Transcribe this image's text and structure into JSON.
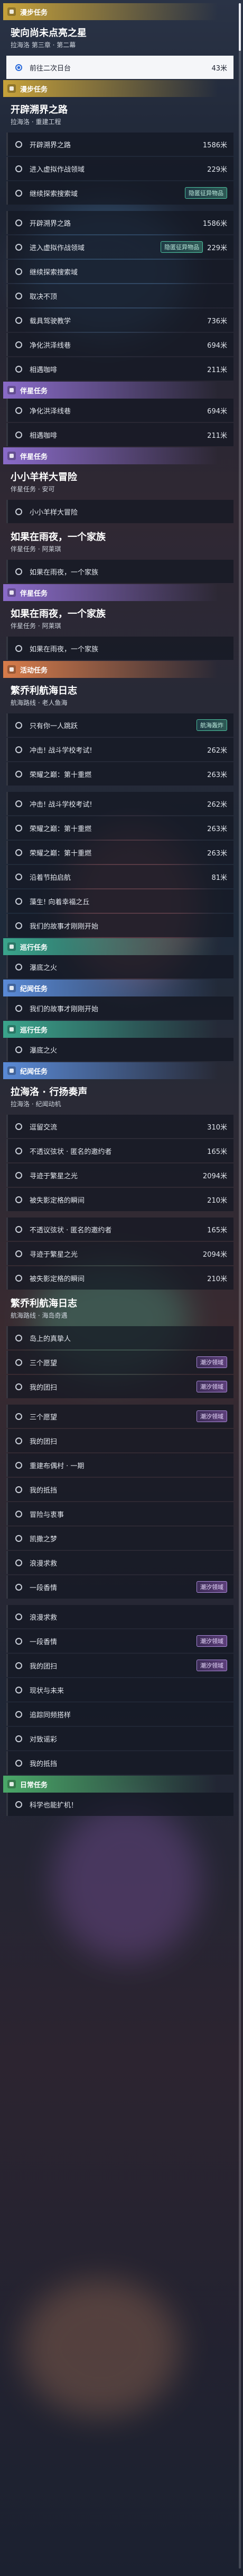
{
  "colors": {
    "mainline": "#c7a23a",
    "bond": "#8a6bc9",
    "event": "#d87c4a",
    "tour": "#3aa58c",
    "story": "#5a8ad6",
    "wild": "#4aa868"
  },
  "entries": [
    {
      "kind": "header",
      "label": "漫步任务",
      "color": "#c7a23a",
      "icon": "star-icon"
    },
    {
      "kind": "title",
      "text": "驶向尚未点亮之星",
      "sub": "拉海洛 第三章 · 第二幕"
    },
    {
      "kind": "row",
      "text": "前往二次日台",
      "dist": "43米",
      "selected": true
    },
    {
      "kind": "header",
      "label": "漫步任务",
      "color": "#c7a23a",
      "icon": "star-icon"
    },
    {
      "kind": "title",
      "text": "开辟溯界之路",
      "sub": "拉海洛 · 重建工程"
    },
    {
      "kind": "row",
      "text": "开辟溯界之路",
      "dist": "1586米"
    },
    {
      "kind": "row",
      "text": "进入虚拟作战领域",
      "dist": "229米"
    },
    {
      "kind": "row",
      "text": "继续探索搜索域",
      "badge": "隐匿征异物品"
    },
    {
      "kind": "gap"
    },
    {
      "kind": "row",
      "text": "开辟溯界之路",
      "dist": "1586米"
    },
    {
      "kind": "row",
      "text": "进入虚拟作战领域",
      "dist": "229米",
      "badge": "隐匿征异物品"
    },
    {
      "kind": "row",
      "text": "继续探索搜索域"
    },
    {
      "kind": "row",
      "text": "取决不顶"
    },
    {
      "kind": "row",
      "text": "载具驾驶教学",
      "dist": "736米"
    },
    {
      "kind": "row",
      "text": "净化洪泽线巷",
      "dist": "694米"
    },
    {
      "kind": "row",
      "text": "相遇咖啡",
      "dist": "211米"
    },
    {
      "kind": "header",
      "label": "伴星任务",
      "color": "#8a6bc9",
      "icon": "heart-icon"
    },
    {
      "kind": "row",
      "text": "净化洪泽线巷",
      "dist": "694米"
    },
    {
      "kind": "row",
      "text": "相遇咖啡",
      "dist": "211米"
    },
    {
      "kind": "header",
      "label": "伴星任务",
      "color": "#8a6bc9",
      "icon": "heart-icon"
    },
    {
      "kind": "title",
      "text": "小小羊样大冒险",
      "sub": "伴星任务 · 安可"
    },
    {
      "kind": "row",
      "text": "小小羊样大冒险"
    },
    {
      "kind": "title",
      "text": "如果在雨夜，一个家族",
      "sub": "伴星任务 · 阿莱琪"
    },
    {
      "kind": "row",
      "text": "如果在雨夜，一个家族"
    },
    {
      "kind": "header",
      "label": "伴星任务",
      "color": "#8a6bc9",
      "icon": "heart-icon"
    },
    {
      "kind": "title",
      "text": "如果在雨夜，一个家族",
      "sub": "伴星任务 · 阿莱琪"
    },
    {
      "kind": "row",
      "text": "如果在雨夜，一个家族"
    },
    {
      "kind": "header",
      "label": "活动任务",
      "color": "#d87c4a",
      "icon": "flag-icon"
    },
    {
      "kind": "title",
      "text": "繁乔利航海日志",
      "sub": "航海路线 · 老人鱼海"
    },
    {
      "kind": "row",
      "text": "只有你一人跳跃",
      "badge": "航海轰炸"
    },
    {
      "kind": "row",
      "text": "冲击! 战斗学校考试!",
      "dist": "262米"
    },
    {
      "kind": "row",
      "text": "荣耀之巅：第十重燃",
      "dist": "263米"
    },
    {
      "kind": "gap"
    },
    {
      "kind": "row",
      "text": "冲击! 战斗学校考试!",
      "dist": "262米"
    },
    {
      "kind": "row",
      "text": "荣耀之巅：第十重燃",
      "dist": "263米"
    },
    {
      "kind": "row",
      "text": "荣耀之巅：第十重燃",
      "dist": "263米"
    },
    {
      "kind": "row",
      "text": "沿着节拍启航",
      "dist": "81米"
    },
    {
      "kind": "row",
      "text": "藻生! 向着幸福之丘"
    },
    {
      "kind": "row",
      "text": "我们的故事才刚刚开始"
    },
    {
      "kind": "header",
      "label": "巡行任务",
      "color": "#3aa58c",
      "icon": "compass-icon"
    },
    {
      "kind": "row",
      "text": "瀑底之火"
    },
    {
      "kind": "header",
      "label": "纪闻任务",
      "color": "#5a8ad6",
      "icon": "book-icon"
    },
    {
      "kind": "row",
      "text": "我们的故事才刚刚开始"
    },
    {
      "kind": "header",
      "label": "巡行任务",
      "color": "#3aa58c",
      "icon": "compass-icon"
    },
    {
      "kind": "row",
      "text": "瀑底之火"
    },
    {
      "kind": "header",
      "label": "纪闻任务",
      "color": "#5a8ad6",
      "icon": "book-icon"
    },
    {
      "kind": "title",
      "text": "拉海洛 · 行扬奏声",
      "sub": "拉海洛 · 纪闻动机"
    },
    {
      "kind": "row",
      "text": "逗留交流",
      "dist": "310米"
    },
    {
      "kind": "row",
      "text": "不透议弦状 · 匿名的邀约者",
      "dist": "165米"
    },
    {
      "kind": "row",
      "text": "寻迹于繁星之光",
      "dist": "2094米"
    },
    {
      "kind": "row",
      "text": "被失影定格的瞬间",
      "dist": "210米"
    },
    {
      "kind": "gap"
    },
    {
      "kind": "row",
      "text": "不透议弦状 · 匿名的邀约者",
      "dist": "165米"
    },
    {
      "kind": "row",
      "text": "寻迹于繁星之光",
      "dist": "2094米"
    },
    {
      "kind": "row",
      "text": "被失影定格的瞬间",
      "dist": "210米"
    },
    {
      "kind": "title",
      "text": "繁乔利航海日志",
      "sub": "航海路线 · 海岛奇遇"
    },
    {
      "kind": "row",
      "text": "岛上的真挚人"
    },
    {
      "kind": "row",
      "text": "三个愿望",
      "badge2": "潮汐领域"
    },
    {
      "kind": "row",
      "text": "我的团扫",
      "badge2": "潮汐领域"
    },
    {
      "kind": "gap"
    },
    {
      "kind": "row",
      "text": "三个愿望",
      "badge2": "潮汐领域"
    },
    {
      "kind": "row",
      "text": "我的团扫"
    },
    {
      "kind": "row",
      "text": "重建布偶村 · 一期"
    },
    {
      "kind": "row",
      "text": "我的抵挡"
    },
    {
      "kind": "row",
      "text": "冒险与衷事"
    },
    {
      "kind": "row",
      "text": "凯撒之梦"
    },
    {
      "kind": "row",
      "text": "浪漫求救"
    },
    {
      "kind": "row",
      "text": "一段香情",
      "badge2": "潮汐领域"
    },
    {
      "kind": "gap"
    },
    {
      "kind": "row",
      "text": "浪漫求救"
    },
    {
      "kind": "row",
      "text": "一段香情",
      "badge2": "潮汐领域"
    },
    {
      "kind": "row",
      "text": "我的团扫",
      "badge2": "潮汐领域"
    },
    {
      "kind": "row",
      "text": "现状与未来"
    },
    {
      "kind": "row",
      "text": "追踪同频搭样"
    },
    {
      "kind": "row",
      "text": "对致谣彩"
    },
    {
      "kind": "row",
      "text": "我的抵挡"
    },
    {
      "kind": "header",
      "label": "日常任务",
      "color": "#4aa868",
      "icon": "leaf-icon"
    },
    {
      "kind": "row",
      "text": "科学也能扩机！"
    }
  ]
}
